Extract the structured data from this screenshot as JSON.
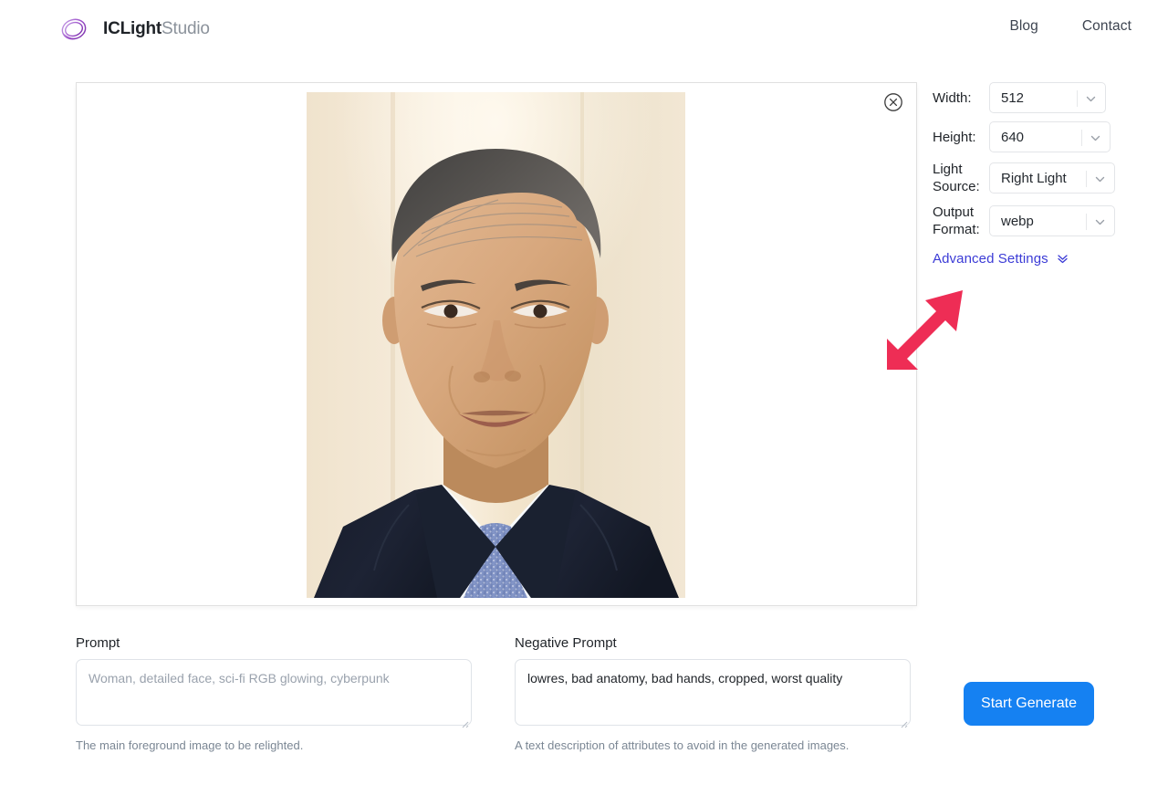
{
  "header": {
    "logo_icon": "spiral-swirl-logo",
    "brand_bold": "ICLight",
    "brand_light": "Studio",
    "nav": [
      {
        "label": "Blog"
      },
      {
        "label": "Contact"
      }
    ]
  },
  "image_panel": {
    "close_icon": "circle-x-icon",
    "photo_alt": "Portrait of a man in a dark navy suit, white shirt and light blue patterned tie against a cream background",
    "photo_colors": {
      "background_light": "#f7ecd8",
      "background_mid": "#efe0c7",
      "skin": "#d8a983",
      "hair": "#4c4a4c",
      "suit": "#1b2030",
      "shirt": "#f4f6f8",
      "tie": "#7f93c4"
    }
  },
  "settings": {
    "width": {
      "label": "Width:",
      "value": "512"
    },
    "height": {
      "label": "Height:",
      "value": "640"
    },
    "light_source": {
      "label": "Light Source:",
      "value": "Right Light"
    },
    "output_format": {
      "label": "Output Format:",
      "value": "webp"
    },
    "advanced": {
      "label": "Advanced Settings",
      "icon": "double-chevron-down-icon",
      "color": "#3b3bd6"
    }
  },
  "annotation": {
    "arrow_icon": "arrow-up-right-annotation",
    "color": "#ee2d55"
  },
  "prompt": {
    "label": "Prompt",
    "value": "",
    "placeholder": "Woman, detailed face, sci-fi RGB glowing, cyberpunk",
    "helper": "The main foreground image to be relighted."
  },
  "negative_prompt": {
    "label": "Negative Prompt",
    "value": "lowres, bad anatomy, bad hands, cropped, worst quality",
    "placeholder": "",
    "helper": "A text description of attributes to avoid in the generated images."
  },
  "actions": {
    "generate_label": "Start Generate",
    "generate_color": "#1581f2"
  }
}
